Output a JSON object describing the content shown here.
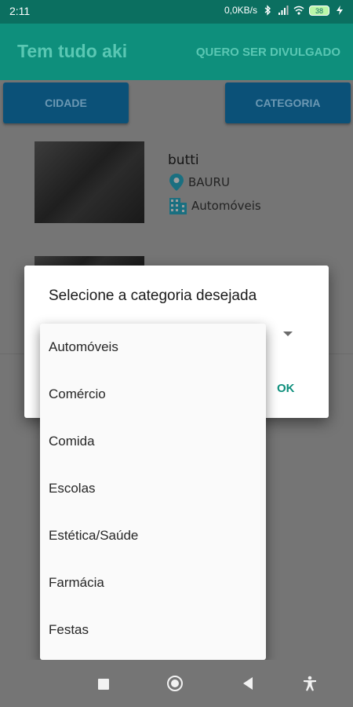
{
  "status_bar": {
    "time": "2:11",
    "net_speed": "0,0KB/s",
    "battery": "38"
  },
  "app_bar": {
    "title": "Tem tudo aki",
    "action": "QUERO SER DIVULGADO"
  },
  "filters": {
    "city_button": "CIDADE",
    "category_button": "CATEGORIA"
  },
  "listing": {
    "name": "butti",
    "city": "BAURU",
    "category": "Automóveis",
    "location_icon": "location-pin-icon",
    "category_icon": "building-icon"
  },
  "dialog": {
    "title": "Selecione a categoria desejada",
    "ok": "OK"
  },
  "menu": {
    "items": [
      {
        "label": "Automóveis"
      },
      {
        "label": "Comércio"
      },
      {
        "label": "Comida"
      },
      {
        "label": "Escolas"
      },
      {
        "label": "Estética/Saúde"
      },
      {
        "label": "Farmácia"
      },
      {
        "label": "Festas"
      }
    ]
  },
  "colors": {
    "primary_dark": "#0b6f60",
    "primary": "#0e8f7c",
    "button": "#0b5178",
    "accent_icon": "#1a8aa3"
  }
}
